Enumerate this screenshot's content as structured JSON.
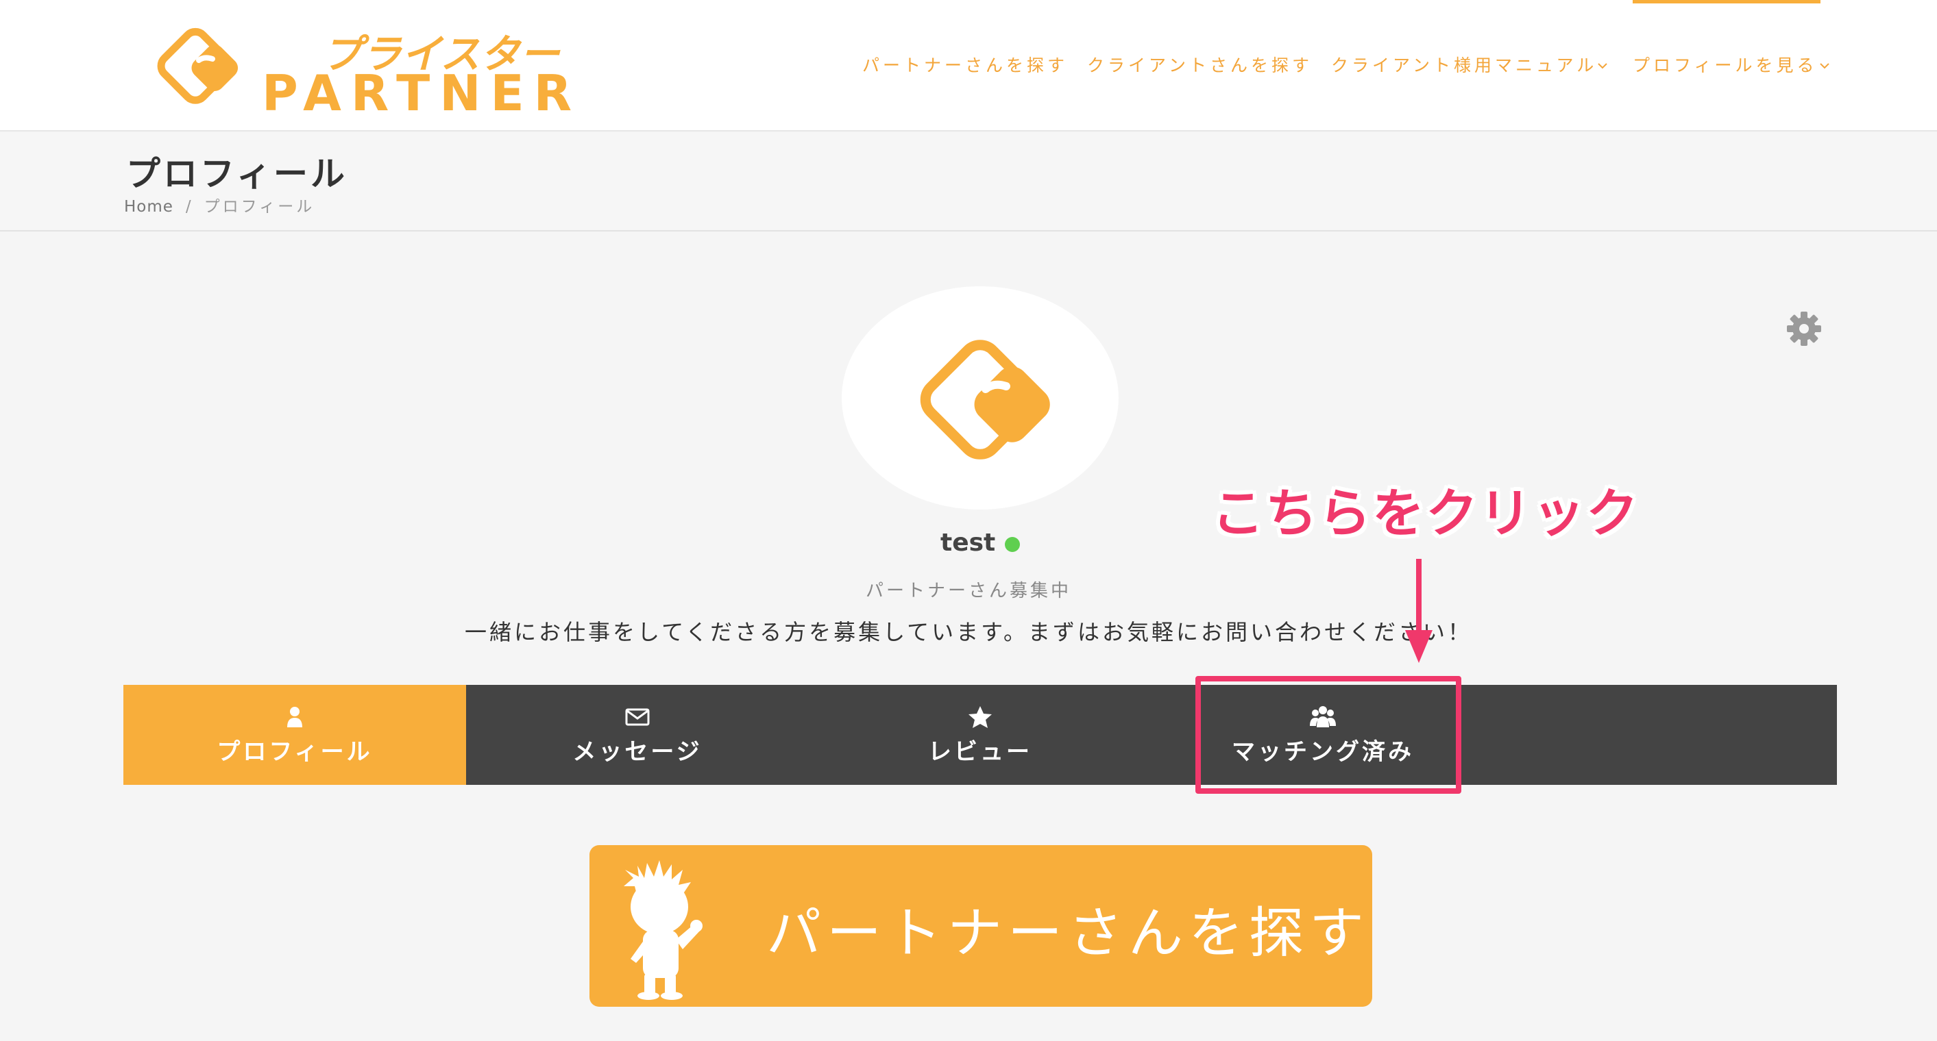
{
  "header": {
    "logo_kana": "プライスター",
    "logo_word": "PARTNER",
    "nav": [
      {
        "label": "パートナーさんを探す",
        "has_dropdown": false
      },
      {
        "label": "クライアントさんを探す",
        "has_dropdown": false
      },
      {
        "label": "クライアント様用マニュアル",
        "has_dropdown": true
      },
      {
        "label": "プロフィールを見る",
        "has_dropdown": true,
        "active": true
      }
    ]
  },
  "title_bar": {
    "title": "プロフィール",
    "breadcrumb": {
      "home": "Home",
      "separator": "/",
      "current": "プロフィール"
    }
  },
  "profile": {
    "name": "test",
    "online": true,
    "status": "パートナーさん募集中",
    "bio": "一緒にお仕事をしてくださる方を募集しています。まずはお気軽にお問い合わせください！"
  },
  "tabs": [
    {
      "label": "プロフィール",
      "icon": "user-icon",
      "active": true
    },
    {
      "label": "メッセージ",
      "icon": "envelope-icon",
      "active": false
    },
    {
      "label": "レビュー",
      "icon": "star-icon",
      "active": false
    },
    {
      "label": "マッチング済み",
      "icon": "users-icon",
      "active": false
    }
  ],
  "annotation": {
    "callout": "こちらをクリック"
  },
  "banner": {
    "label": "パートナーさんを探す"
  },
  "colors": {
    "brand_orange": "#f8ae3b",
    "tab_bar_dark": "#444444",
    "annotation_pink": "#f0386b",
    "online_green": "#5fcf4f"
  }
}
